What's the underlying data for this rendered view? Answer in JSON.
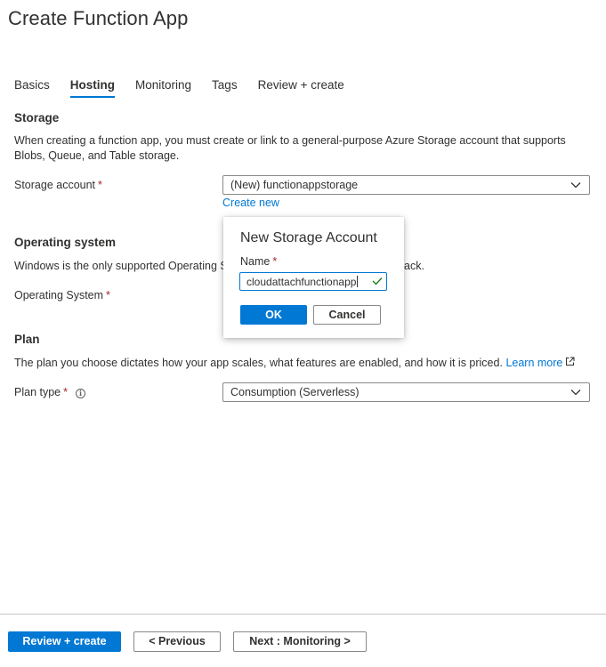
{
  "page": {
    "title": "Create Function App"
  },
  "tabs": [
    {
      "label": "Basics"
    },
    {
      "label": "Hosting"
    },
    {
      "label": "Monitoring"
    },
    {
      "label": "Tags"
    },
    {
      "label": "Review + create"
    }
  ],
  "storage": {
    "heading": "Storage",
    "description": "When creating a function app, you must create or link to a general-purpose Azure Storage account that supports Blobs, Queue, and Table storage.",
    "account_label": "Storage account",
    "required_mark": "*",
    "account_value": "(New) functionappstorage",
    "create_new_link": "Create new"
  },
  "os": {
    "heading": "Operating system",
    "description_left": "Windows is the only supported Operating S",
    "description_right": "ack.",
    "label": "Operating System",
    "required_mark": "*"
  },
  "plan": {
    "heading": "Plan",
    "description": "The plan you choose dictates how your app scales, what features are enabled, and how it is priced.",
    "learn_more": "Learn more",
    "type_label": "Plan type",
    "required_mark": "*",
    "type_value": "Consumption (Serverless)"
  },
  "popup": {
    "title": "New Storage Account",
    "name_label": "Name",
    "required_mark": "*",
    "name_value": "cloudattachfunctionapp",
    "ok_label": "OK",
    "cancel_label": "Cancel"
  },
  "footer": {
    "review_create": "Review + create",
    "previous": "< Previous",
    "next": "Next : Monitoring >"
  },
  "icons": {
    "chevron": "chevron-down-icon",
    "check": "checkmark-icon",
    "external": "external-link-icon",
    "info": "info-icon"
  },
  "colors": {
    "accent": "#0078d4",
    "required": "#a4262c",
    "valid": "#107c10"
  }
}
